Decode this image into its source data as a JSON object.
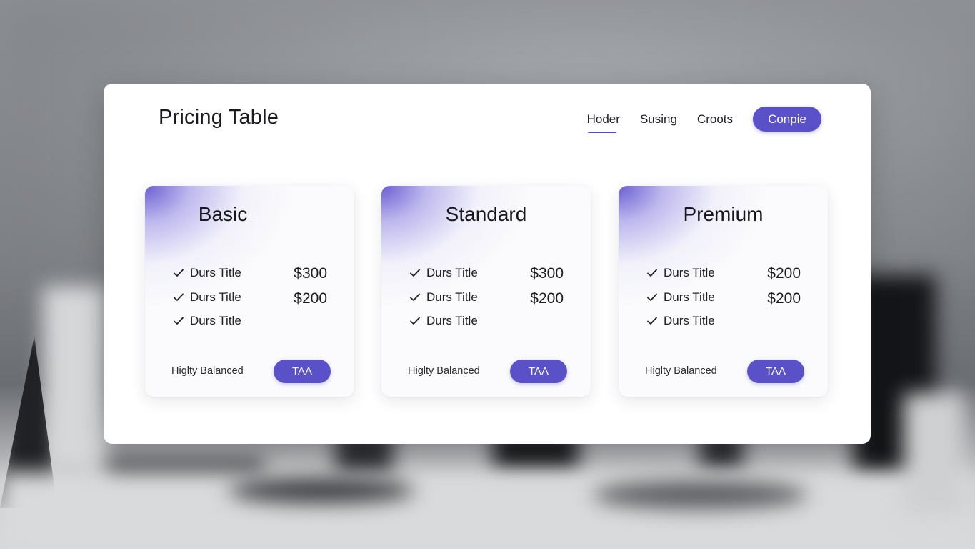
{
  "header": {
    "title": "Pricing Table",
    "nav": [
      "Hoder",
      "Susing",
      "Croots"
    ],
    "cta_label": "Conpie"
  },
  "colors": {
    "accent": "#5a50c8",
    "panel_bg": "#ffffff",
    "gradient": "#6256d0"
  },
  "icons": {
    "feature_check": "check-icon"
  },
  "plans": [
    {
      "name": "Basic",
      "features": [
        "Durs Title",
        "Durs Title",
        "Durs Title"
      ],
      "prices": [
        "$300",
        "$200"
      ],
      "footer_note": "Higlty Balanced",
      "button_label": "TAA"
    },
    {
      "name": "Standard",
      "features": [
        "Durs Title",
        "Durs Title",
        "Durs Title"
      ],
      "prices": [
        "$300",
        "$200"
      ],
      "footer_note": "Higlty Balanced",
      "button_label": "TAA"
    },
    {
      "name": "Premium",
      "features": [
        "Durs Title",
        "Durs Title",
        "Durs Title"
      ],
      "prices": [
        "$200",
        "$200"
      ],
      "footer_note": "Higlty Balanced",
      "button_label": "TAA"
    }
  ]
}
